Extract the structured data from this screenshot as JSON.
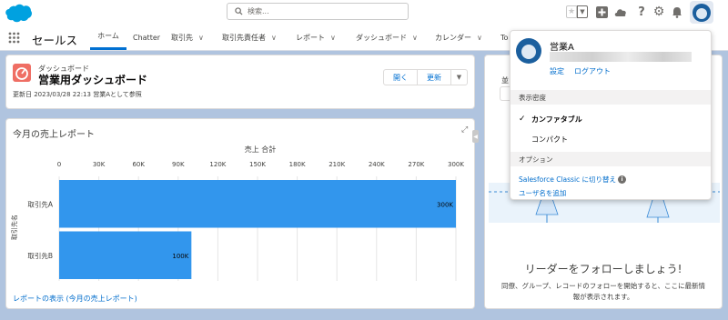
{
  "header": {
    "search_placeholder": "検索..."
  },
  "nav": {
    "app_name": "セールス",
    "items": [
      {
        "label": "ホーム"
      },
      {
        "label": "Chatter"
      },
      {
        "label": "取引先"
      },
      {
        "label": "取引先責任者"
      },
      {
        "label": "レポート"
      },
      {
        "label": "ダッシュボード"
      },
      {
        "label": "カレンダー"
      },
      {
        "label": "To"
      }
    ]
  },
  "dashboard": {
    "type_label": "ダッシュボード",
    "title": "営業用ダッシュボード",
    "meta": "更新日 2023/03/28 22:13 営業Aとして参照",
    "open_label": "開く",
    "refresh_label": "更新"
  },
  "card": {
    "title": "今月の売上レポート",
    "report_link": "レポートの表示 (今月の売上レポート)"
  },
  "right_card": {
    "label_partial": "並",
    "follow_title": "リーダーをフォローしましょう!",
    "follow_desc": "同僚、グループ、レコードのフォローを開始すると、ここに最新情報が表示されます。"
  },
  "user_panel": {
    "name": "営業A",
    "settings_label": "設定",
    "logout_label": "ログアウト",
    "density_header": "表示密度",
    "comfortable_label": "カンファタブル",
    "compact_label": "コンパクト",
    "options_header": "オプション",
    "classic_label": "Salesforce Classic に切り替え",
    "add_username_label": "ユーザ名を追加"
  },
  "chart_data": {
    "type": "bar",
    "orientation": "horizontal",
    "title": "売上 合計",
    "ylabel": "取引先名",
    "categories": [
      "取引先A",
      "取引先B"
    ],
    "values": [
      300000,
      100000
    ],
    "value_labels": [
      "300K",
      "100K"
    ],
    "xlim": [
      0,
      300000
    ],
    "ticks": [
      "0",
      "30K",
      "60K",
      "90K",
      "120K",
      "150K",
      "180K",
      "210K",
      "240K",
      "270K",
      "300K"
    ],
    "bar_color": "#3296ed",
    "grid": true
  }
}
